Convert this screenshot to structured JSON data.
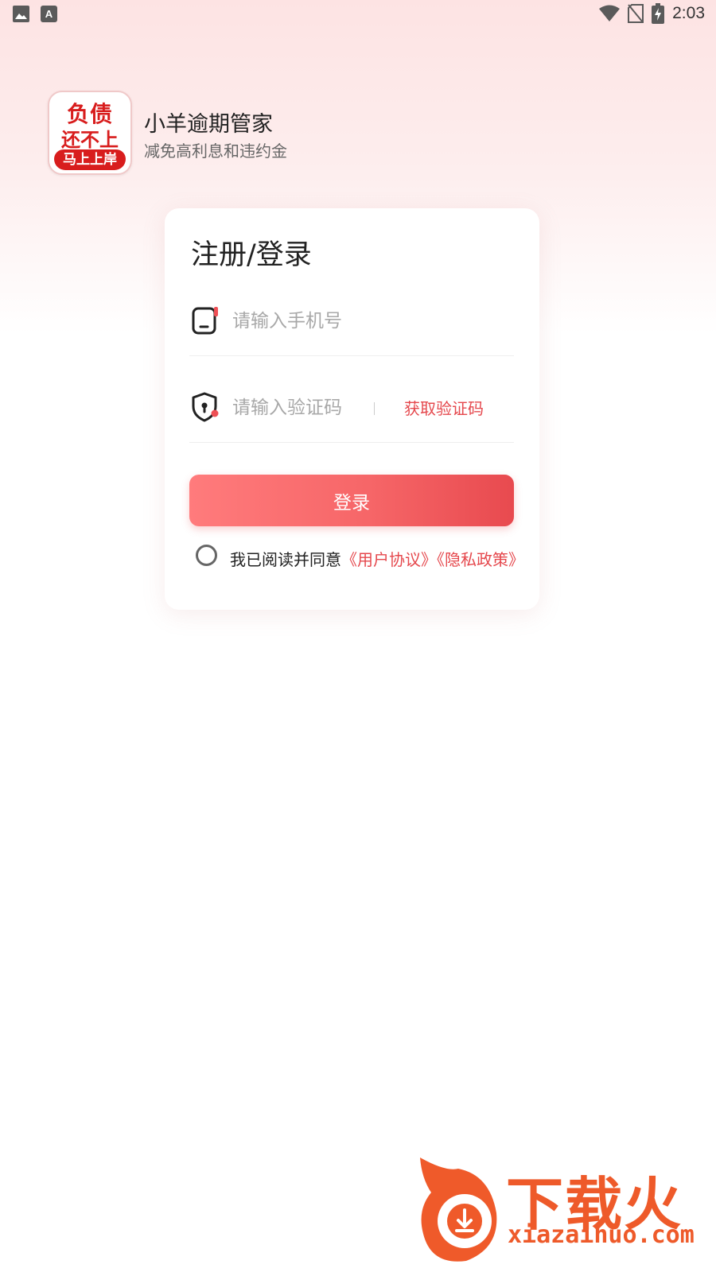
{
  "status_bar": {
    "time": "2:03",
    "left_icons": [
      "image-icon",
      "font-icon"
    ],
    "right_icons": [
      "wifi-icon",
      "no-sim-icon",
      "battery-charging-icon"
    ]
  },
  "app": {
    "logo_line1": "负债",
    "logo_line2": "还不上",
    "logo_banner": "马上上岸",
    "name": "小羊逾期管家",
    "subtitle": "减免高利息和违约金"
  },
  "login_card": {
    "title": "注册/登录",
    "phone_placeholder": "请输入手机号",
    "code_placeholder": "请输入验证码",
    "get_code_label": "获取验证码",
    "login_label": "登录",
    "agreement_prefix": "我已阅读并同意",
    "user_agreement": "《用户协议》",
    "privacy_policy": "《隐私政策》"
  },
  "watermark": {
    "text": "下载火",
    "url": "xiazaihuo.com"
  },
  "colors": {
    "accent": "#e5484d",
    "button_start": "#ff7b7c",
    "button_end": "#e84a4f",
    "logo_red": "#d81d1d",
    "watermark": "#ee5a2a"
  }
}
